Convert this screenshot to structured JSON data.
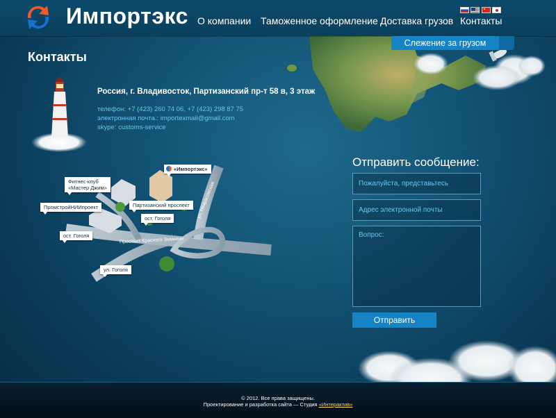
{
  "brand": {
    "name": "Импортэкс"
  },
  "nav": {
    "items": [
      {
        "label": "О компании"
      },
      {
        "label": "Таможенное оформление"
      },
      {
        "label": "Доставка грузов"
      },
      {
        "label": "Контакты"
      }
    ],
    "tracking_label": "Слежение за грузом"
  },
  "contacts": {
    "title": "Контакты",
    "address": "Россия, г. Владивосток, Партизанский пр-т 58 в, 3 этаж",
    "phone": "телефон: +7 (423) 260 74 06, +7 (423) 298 87 75",
    "email": "электронная почта.: importexmail@gmail.com",
    "skype": "skype: customs-service"
  },
  "map": {
    "labels": {
      "company": "«Импортэкс»",
      "fitness_line1": "Фитнес-клуб",
      "fitness_line2": "«Мастер Джим»",
      "promstroy": "ПромстройНИИпроект",
      "partizansky": "Партизанский проспект",
      "stop_gogolya_1": "ост. Гоголя",
      "stop_gogolya_2": "ост. Гоголя",
      "street_gogolya": "ул. Гоголя"
    },
    "roads": {
      "krasnogo_znameni": "Проспект Красного Знамени",
      "nekrasovskaya": "ул. Некрасовская"
    }
  },
  "form": {
    "title": "Отправить сообщение:",
    "name_placeholder": "Пожалуйста, представьтесь",
    "email_placeholder": "Адрес электронной почты",
    "question_placeholder": "Вопрос:",
    "submit_label": "Отправить"
  },
  "footer": {
    "copyright": "© 2012. Все права защищены.",
    "credits_prefix": "Проектирование и разработка сайта — Студия ",
    "studio_link": "«Интерактив»"
  },
  "colors": {
    "accent": "#1683c4",
    "link": "#69c7ef",
    "background": "#135476"
  }
}
